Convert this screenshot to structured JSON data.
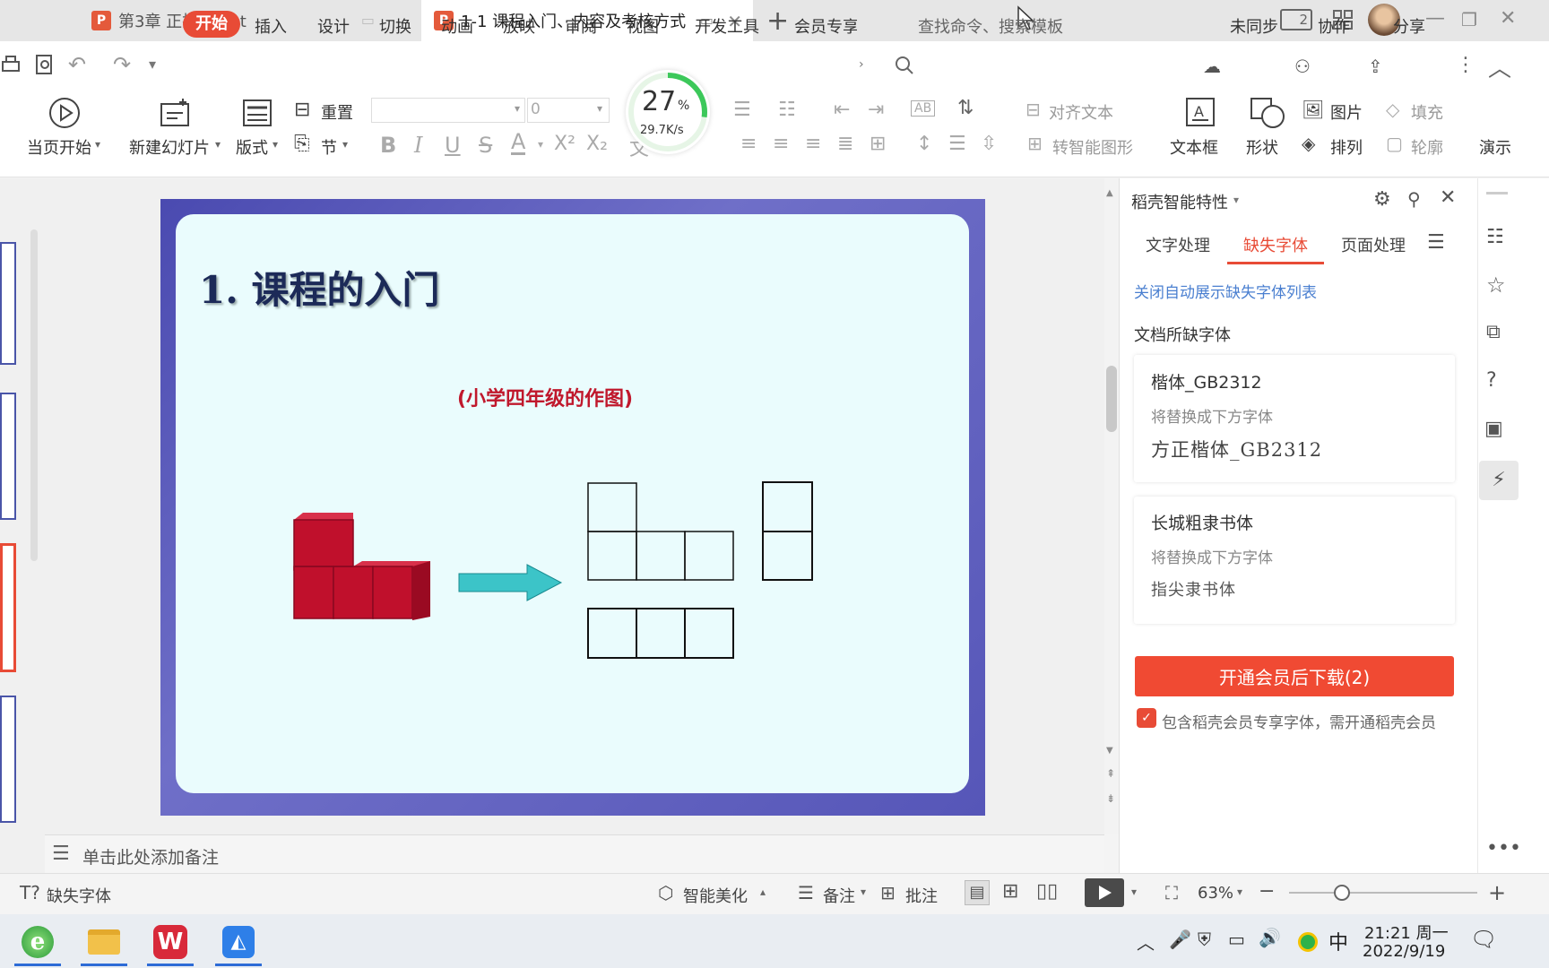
{
  "tabs": [
    {
      "title": "第3章 正投影.ppt",
      "active": false
    },
    {
      "title": "1-1 课程入门、内容及考核方式",
      "active": true
    }
  ],
  "window": {
    "layout_badge": "2"
  },
  "menu": {
    "start": "开始",
    "items": [
      "插入",
      "设计",
      "切换",
      "动画",
      "放映",
      "审阅",
      "视图",
      "开发工具",
      "会员专享"
    ],
    "search_placeholder": "查找命令、搜索模板",
    "unsynced": "未同步",
    "collaborate": "协作",
    "share": "分享"
  },
  "ribbon": {
    "play_from_current": "当页开始",
    "new_slide": "新建幻灯片",
    "layout": "版式",
    "reset": "重置",
    "section": "节",
    "font_size_value": "0",
    "align_text": "对齐文本",
    "smartart": "转智能图形",
    "textbox": "文本框",
    "shape": "形状",
    "picture": "图片",
    "arrange": "排列",
    "fill": "填充",
    "outline": "轮廓",
    "present": "演示",
    "convert_short": "文"
  },
  "upload_widget": {
    "percent": "27",
    "percent_sign": "%",
    "speed": "29.7K/s"
  },
  "slide": {
    "title": "1. 课程的入门",
    "subtitle": "(小学四年级的作图)"
  },
  "notes_placeholder": "单击此处添加备注",
  "panel": {
    "title": "稻壳智能特性",
    "tabs": [
      "文字处理",
      "缺失字体",
      "页面处理"
    ],
    "active_tab": "缺失字体",
    "link": "关闭自动展示缺失字体列表",
    "section_title": "文档所缺字体",
    "fonts": [
      {
        "name": "楷体_GB2312",
        "hint": "将替换成下方字体",
        "replacement": "方正楷体_GB2312"
      },
      {
        "name": "长城粗隶书体",
        "hint": "将替换成下方字体",
        "replacement": "指尖隶书体"
      }
    ],
    "download_button": "开通会员后下载(2)",
    "note": "包含稻壳会员专享字体，需开通稻壳会员"
  },
  "status": {
    "missing_font": "缺失字体",
    "beautify": "智能美化",
    "notes": "备注",
    "comment": "批注",
    "zoom": "63%"
  },
  "taskbar": {
    "ime": "中",
    "time": "21:21 周一",
    "date": "2022/9/19"
  },
  "colors": {
    "accent": "#e84b36",
    "link": "#4a7fd0",
    "slide_frame": "#5454b4",
    "slide_bg": "#eafcfd",
    "cube_red": "#c0102c",
    "arrow_teal": "#3cc4c8"
  }
}
